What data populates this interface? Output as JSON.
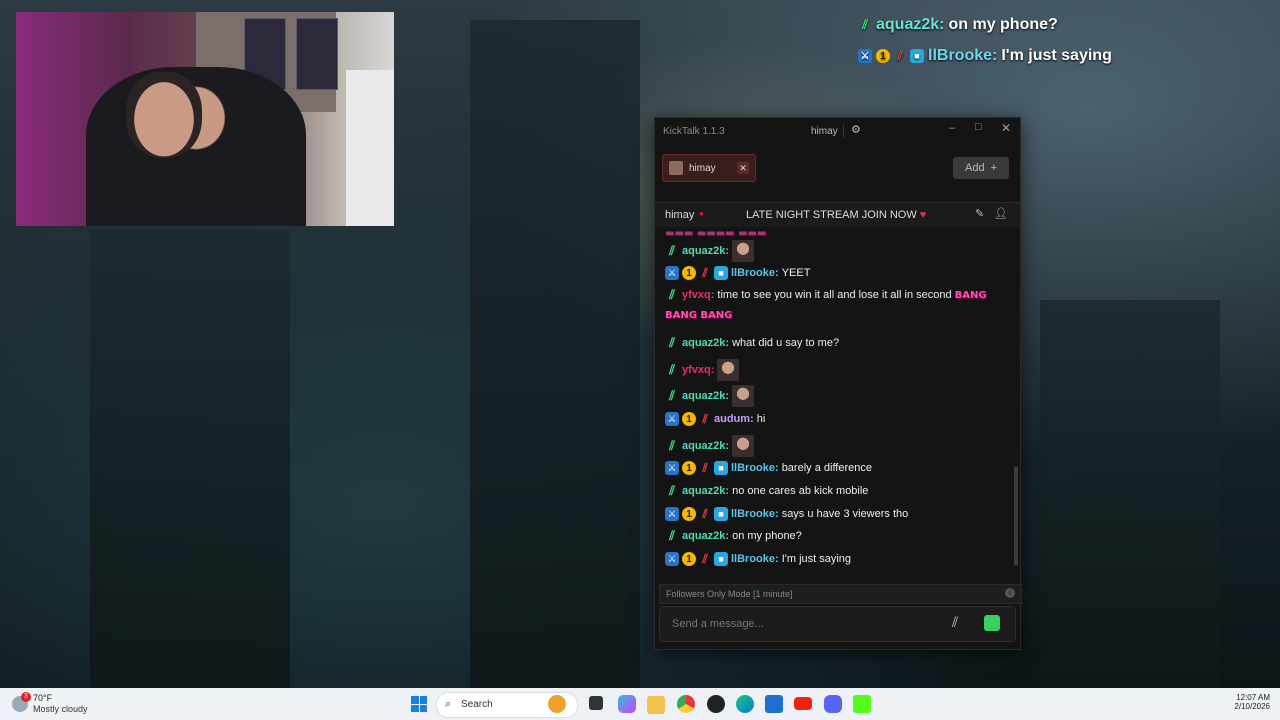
{
  "overlay": {
    "line1": {
      "user": "aquaz2k:",
      "text": "on my phone?"
    },
    "line2": {
      "user": "llBrooke:",
      "text": "I'm just saying"
    }
  },
  "window": {
    "app_title": "KickTalk 1.1.3",
    "current_user": "himay",
    "tab_label": "himay",
    "add_label": "Add",
    "channel_name": "himay",
    "stream_title": "LATE NIGHT STREAM JOIN NOW",
    "messages": [
      {
        "user": "aquaz2k:",
        "text": "",
        "kind": "aq",
        "emote": true
      },
      {
        "user": "llBrooke:",
        "text": "YEET",
        "kind": "br"
      },
      {
        "user": "yfvxq:",
        "text": "time to see you win it all and lose it all in second",
        "kind": "yf",
        "bang": "BANG"
      },
      {
        "user": "",
        "text": "",
        "kind": "cont",
        "bang": "BANG BANG"
      },
      {
        "user": "aquaz2k:",
        "text": "what did u say to me?",
        "kind": "aq"
      },
      {
        "user": "yfvxq:",
        "text": "",
        "kind": "yf",
        "emote": true
      },
      {
        "user": "aquaz2k:",
        "text": "",
        "kind": "aq",
        "emote": true
      },
      {
        "user": "audum:",
        "text": "hi",
        "kind": "au"
      },
      {
        "user": "aquaz2k:",
        "text": "",
        "kind": "aq",
        "emote": true
      },
      {
        "user": "llBrooke:",
        "text": "barely a difference",
        "kind": "br"
      },
      {
        "user": "aquaz2k:",
        "text": "no one cares ab kick mobile",
        "kind": "aq"
      },
      {
        "user": "llBrooke:",
        "text": "says u have 3 viewers tho",
        "kind": "br"
      },
      {
        "user": "aquaz2k:",
        "text": "on my phone?",
        "kind": "aq"
      },
      {
        "user": "llBrooke:",
        "text": "I'm just saying",
        "kind": "br"
      }
    ],
    "mode_text": "Followers Only Mode [1 minute]",
    "input_placeholder": "Send a message..."
  },
  "taskbar": {
    "weather_temp": "70°F",
    "weather_cond": "Mostly cloudy",
    "weather_badge": "3",
    "search_label": "Search",
    "time": "12:07 AM",
    "date": "2/10/2026"
  },
  "colors": {
    "aquaz2k": "#4fdbb6",
    "llBrooke": "#5ec3ea",
    "yfvxq": "#e2336e",
    "audum": "#c59cff"
  }
}
